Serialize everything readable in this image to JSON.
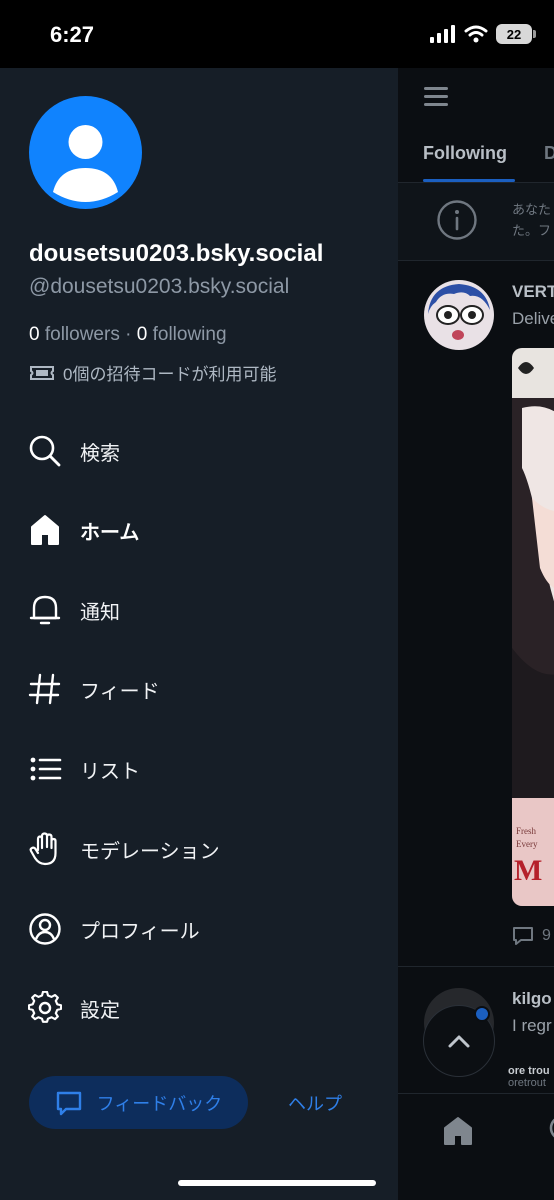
{
  "status_bar": {
    "time": "6:27",
    "battery": "22"
  },
  "profile": {
    "display_name": "dousetsu0203.bsky.social",
    "handle": "@dousetsu0203.bsky.social",
    "followers_count": "0",
    "followers_label": "followers",
    "separator": "·",
    "following_count": "0",
    "following_label": "following",
    "invite_text": "0個の招待コードが利用可能"
  },
  "nav": {
    "items": [
      {
        "label": "検索",
        "icon": "search-icon"
      },
      {
        "label": "ホーム",
        "icon": "home-icon",
        "active": true
      },
      {
        "label": "通知",
        "icon": "bell-icon"
      },
      {
        "label": "フィード",
        "icon": "hash-icon"
      },
      {
        "label": "リスト",
        "icon": "list-icon"
      },
      {
        "label": "モデレーション",
        "icon": "hand-icon"
      },
      {
        "label": "プロフィール",
        "icon": "user-circle-icon"
      },
      {
        "label": "設定",
        "icon": "gear-icon"
      }
    ]
  },
  "footer": {
    "feedback_label": "フィードバック",
    "help_label": "ヘルプ"
  },
  "feed": {
    "tab_following": "Following",
    "tab_next": "D",
    "notice_line1": "あなた",
    "notice_line2": "た。フ",
    "post1": {
      "author": "VERT",
      "text": "Delive",
      "reply_count": "9"
    },
    "post2": {
      "author": "kilgo",
      "text": "I regr",
      "snippet_line1": "ore trou",
      "snippet_line2": "oretrout"
    }
  },
  "colors": {
    "accent": "#1083fe",
    "drawer_bg": "#161e27",
    "link": "#2f7fe8"
  }
}
